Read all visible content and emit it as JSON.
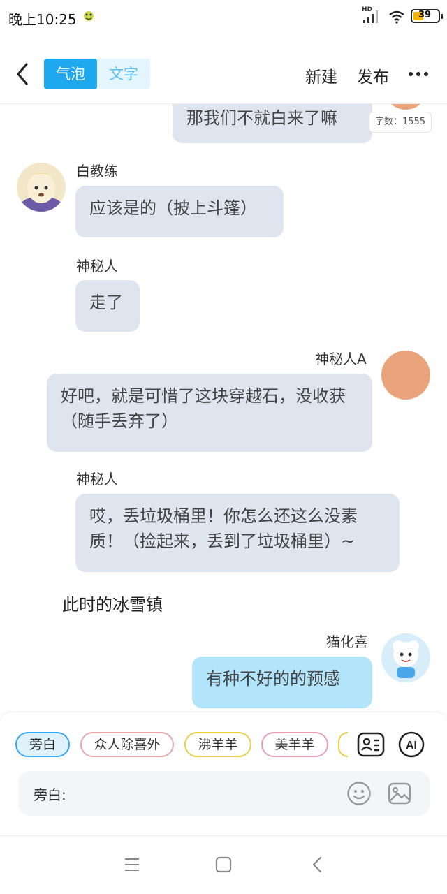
{
  "status_bar": {
    "time": "晚上10:25",
    "network": "HD",
    "battery": "39"
  },
  "header": {
    "tab_bubble": "气泡",
    "tab_text": "文字",
    "new_label": "新建",
    "publish_label": "发布"
  },
  "word_count": "字数：1555",
  "messages": [
    {
      "text": "那我们不就白来了嘛",
      "side": "right"
    },
    {
      "name": "白教练",
      "text": "应该是的（披上斗篷）",
      "side": "left"
    },
    {
      "name": "神秘人",
      "text": "走了",
      "side": "left"
    },
    {
      "name": "神秘人A",
      "text": "好吧，就是可惜了这块穿越石，没收获（随手丢弃了）",
      "side": "right"
    },
    {
      "name": "神秘人",
      "text": "哎，丢垃圾桶里！你怎么还这么没素质！（捡起来，丢到了垃圾桶里）~",
      "side": "left"
    },
    {
      "narration": "此时的冰雪镇"
    },
    {
      "name": "猫化喜",
      "text": "有种不好的的预感",
      "side": "right"
    }
  ],
  "characters": [
    {
      "label": "旁白",
      "selected": true,
      "color": "#3aa6ec"
    },
    {
      "label": "众人除喜外",
      "selected": false,
      "color": "#e8a7ad"
    },
    {
      "label": "沸羊羊",
      "selected": false,
      "color": "#e8cf4a"
    },
    {
      "label": "美羊羊",
      "selected": false,
      "color": "#e6a0b4"
    }
  ],
  "input": {
    "label": "旁白:"
  },
  "icons": {
    "back": "chevron-left-icon",
    "more": "more-dots-icon",
    "role_card": "role-card-icon",
    "ai": "ai-icon",
    "emoji": "emoji-icon",
    "image": "image-icon"
  },
  "colors": {
    "accent": "#1ea8ee",
    "bubble_other": "#dfe5ee",
    "bubble_self": "#b2e4fb"
  }
}
